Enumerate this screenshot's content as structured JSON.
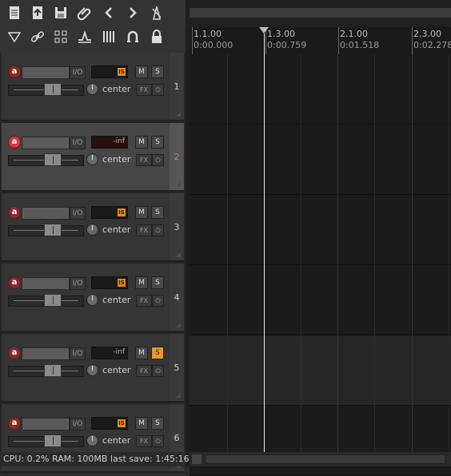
{
  "toolbar": {
    "buttons": [
      {
        "name": "new-project-icon"
      },
      {
        "name": "open-project-icon"
      },
      {
        "name": "save-project-icon"
      },
      {
        "name": "attach-icon"
      },
      {
        "name": "undo-icon"
      },
      {
        "name": "redo-icon"
      },
      {
        "name": "metronome-icon"
      },
      {
        "name": "item-selection-icon"
      },
      {
        "name": "link-icon"
      },
      {
        "name": "grid-icon"
      },
      {
        "name": "envelope-icon"
      },
      {
        "name": "snap-bars-icon"
      },
      {
        "name": "loop-icon"
      },
      {
        "name": "lock-icon"
      }
    ]
  },
  "ruler": {
    "marks": [
      {
        "beat": "1.1.00",
        "time": "0:00.000"
      },
      {
        "beat": "1.3.00",
        "time": "0:00.759"
      },
      {
        "beat": "2.1.00",
        "time": "0:01.518"
      },
      {
        "beat": "2.3.00",
        "time": "0:02.278"
      }
    ]
  },
  "tracks": [
    {
      "number": "1",
      "io_label": "I/O",
      "meter": "IS",
      "mute_label": "M",
      "solo_label": "S",
      "solo_on": false,
      "armed": false,
      "selected": false,
      "pan_label": "center",
      "fx_label": "FX",
      "power_label": "⏻",
      "arm_label": "a"
    },
    {
      "number": "2",
      "io_label": "I/O",
      "meter": "-inf",
      "mute_label": "M",
      "solo_label": "S",
      "solo_on": false,
      "armed": true,
      "selected": true,
      "pan_label": "center",
      "fx_label": "FX",
      "power_label": "⏻",
      "arm_label": "a"
    },
    {
      "number": "3",
      "io_label": "I/O",
      "meter": "IS",
      "mute_label": "M",
      "solo_label": "S",
      "solo_on": false,
      "armed": false,
      "selected": false,
      "pan_label": "center",
      "fx_label": "FX",
      "power_label": "⏻",
      "arm_label": "a"
    },
    {
      "number": "4",
      "io_label": "I/O",
      "meter": "IS",
      "mute_label": "M",
      "solo_label": "S",
      "solo_on": false,
      "armed": false,
      "selected": false,
      "pan_label": "center",
      "fx_label": "FX",
      "power_label": "⏻",
      "arm_label": "a"
    },
    {
      "number": "5",
      "io_label": "I/O",
      "meter": "-inf",
      "mute_label": "M",
      "solo_label": "S",
      "solo_on": true,
      "armed": false,
      "selected": false,
      "pan_label": "center",
      "fx_label": "FX",
      "power_label": "⏻",
      "arm_label": "a"
    },
    {
      "number": "6",
      "io_label": "I/O",
      "meter": "IS",
      "mute_label": "M",
      "solo_label": "S",
      "solo_on": false,
      "armed": false,
      "selected": false,
      "pan_label": "center",
      "fx_label": "FX",
      "power_label": "⏻",
      "arm_label": "a"
    }
  ],
  "status": {
    "text": "CPU: 0.2%  RAM: 100MB  last save: 1:45:16"
  },
  "colors": {
    "accent_orange": "#e69a2a",
    "record_red": "#d43a3a",
    "playhead": "#e6e6e6"
  }
}
